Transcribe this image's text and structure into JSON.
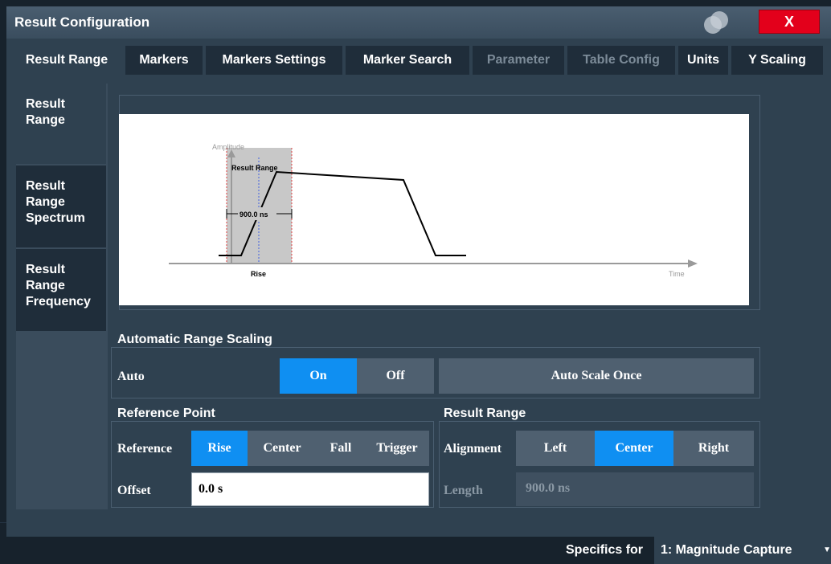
{
  "window": {
    "title": "Result Configuration",
    "close_label": "X"
  },
  "tabs": [
    {
      "label": "Result Range",
      "active": true,
      "disabled": false
    },
    {
      "label": "Markers",
      "active": false,
      "disabled": false
    },
    {
      "label": "Markers Settings",
      "active": false,
      "disabled": false
    },
    {
      "label": "Marker Search",
      "active": false,
      "disabled": false
    },
    {
      "label": "Parameter",
      "active": false,
      "disabled": true
    },
    {
      "label": "Table Config",
      "active": false,
      "disabled": true
    },
    {
      "label": "Units",
      "active": false,
      "disabled": false
    },
    {
      "label": "Y Scaling",
      "active": false,
      "disabled": false
    }
  ],
  "subtabs": [
    {
      "label": "Result Range",
      "active": true
    },
    {
      "label": "Result Range Spectrum",
      "active": false
    },
    {
      "label": "Result Range Frequency",
      "active": false
    }
  ],
  "diagram": {
    "amplitude_label": "Amplitude",
    "result_range_label": "Result Range",
    "length_label": "900.0 ns",
    "rise_label": "Rise",
    "time_label": "Time"
  },
  "auto_scaling": {
    "title": "Automatic Range Scaling",
    "auto_label": "Auto",
    "on_label": "On",
    "off_label": "Off",
    "selected": "On",
    "auto_scale_once_label": "Auto Scale Once"
  },
  "reference_point": {
    "title": "Reference Point",
    "reference_label": "Reference",
    "options": [
      "Rise",
      "Center",
      "Fall",
      "Trigger"
    ],
    "selected": "Rise",
    "offset_label": "Offset",
    "offset_value": "0.0 s"
  },
  "result_range": {
    "title": "Result Range",
    "alignment_label": "Alignment",
    "options": [
      "Left",
      "Center",
      "Right"
    ],
    "selected": "Center",
    "length_label": "Length",
    "length_value": "900.0 ns"
  },
  "footer": {
    "specifics_label": "Specifics for",
    "specifics_value": "1: Magnitude Capture"
  },
  "colors": {
    "accent": "#0f8ff2",
    "close": "#e3001b",
    "panel": "#2f4150"
  }
}
